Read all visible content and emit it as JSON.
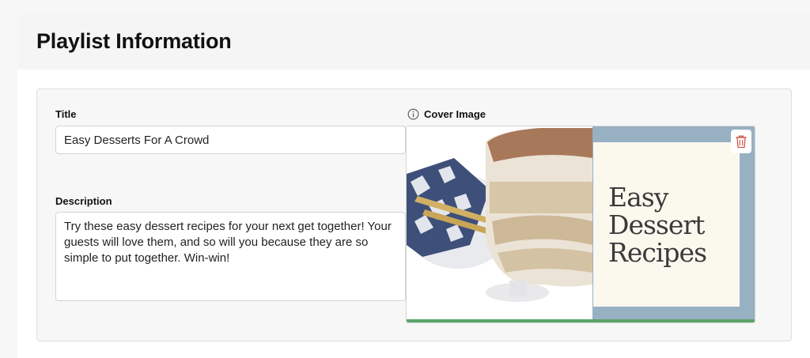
{
  "page": {
    "title": "Playlist Information"
  },
  "form": {
    "title": {
      "label": "Title",
      "value": "Easy Desserts For A Crowd"
    },
    "description": {
      "label": "Description",
      "value": "Try these easy dessert recipes for your next get together! Your guests will love them, and so will you because they are so simple to put together. Win-win!"
    },
    "cover": {
      "label": "Cover Image",
      "info_icon": "info-icon",
      "delete_icon": "trash-icon",
      "image_text": [
        "Easy",
        "Dessert",
        "Recipes"
      ]
    }
  },
  "colors": {
    "cover_frame": "#97b0c2",
    "cover_panel": "#fbf8ee",
    "cover_bar": "#5aa469",
    "delete_icon": "#d4574b"
  }
}
